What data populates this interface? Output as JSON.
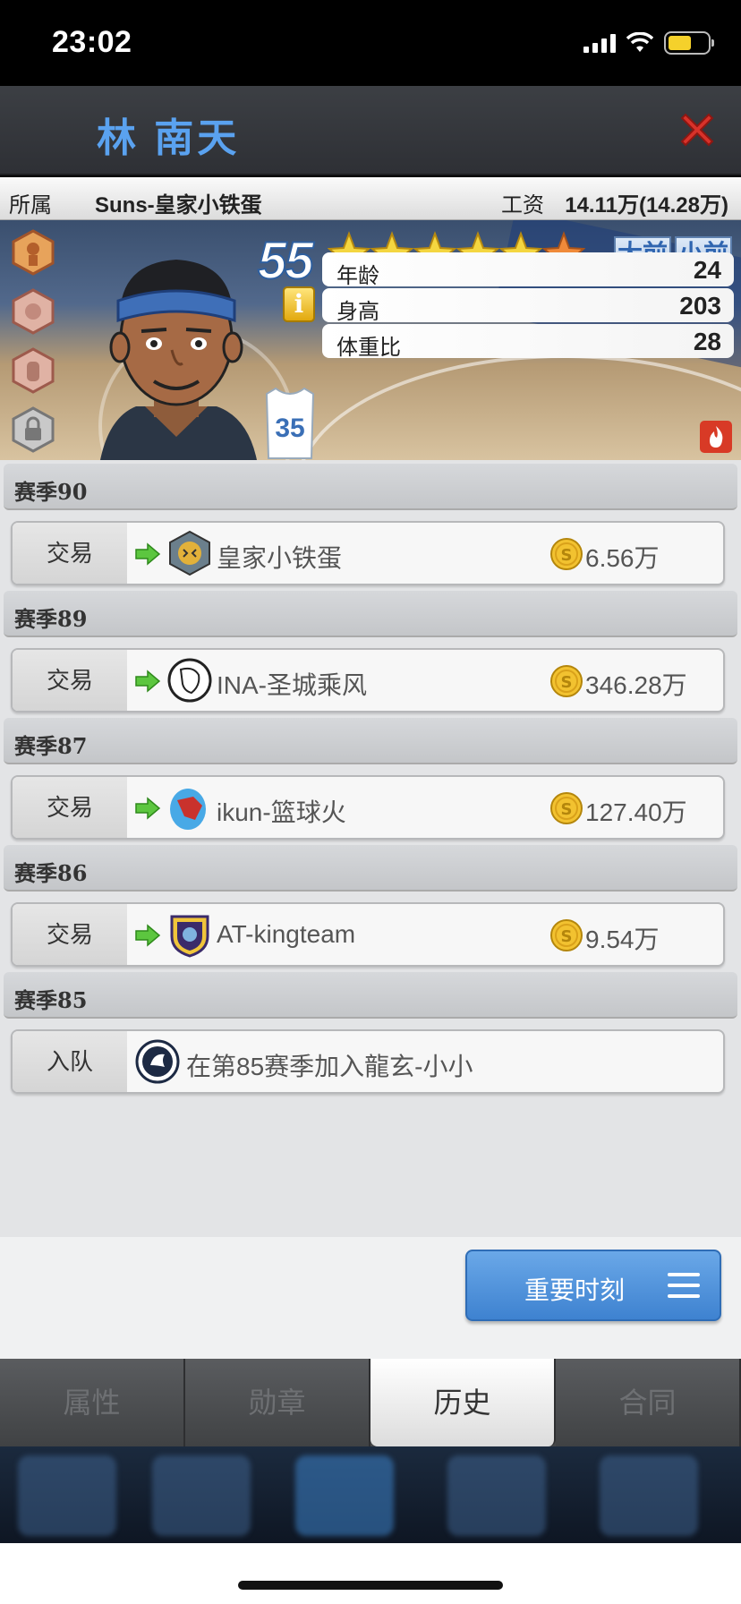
{
  "status_bar": {
    "time": "23:02"
  },
  "header": {
    "player_name": "林 南天"
  },
  "info": {
    "team_label": "所属",
    "team_value": "Suns-皇家小铁蛋",
    "salary_label": "工资",
    "salary_value": "14.11万(14.28万)"
  },
  "card": {
    "rating": "55",
    "stars": 5.5,
    "positions": [
      "大前",
      "小前"
    ],
    "jersey_number": "35",
    "stats": [
      {
        "label": "年龄",
        "value": "24"
      },
      {
        "label": "身高",
        "value": "203"
      },
      {
        "label": "体重比",
        "value": "28"
      }
    ]
  },
  "history": [
    {
      "season": "赛季90",
      "entries": [
        {
          "type": "交易",
          "team": "皇家小铁蛋",
          "amount": "6.56万"
        }
      ]
    },
    {
      "season": "赛季89",
      "entries": [
        {
          "type": "交易",
          "team": "INA-圣城乘风",
          "amount": "346.28万"
        }
      ]
    },
    {
      "season": "赛季87",
      "entries": [
        {
          "type": "交易",
          "team": "ikun-篮球火",
          "amount": "127.40万"
        }
      ]
    },
    {
      "season": "赛季86",
      "entries": [
        {
          "type": "交易",
          "team": "AT-kingteam",
          "amount": "9.54万"
        }
      ]
    },
    {
      "season": "赛季85",
      "entries": [
        {
          "type": "入队",
          "team": "在第85赛季加入龍玄-小小",
          "amount": ""
        }
      ]
    }
  ],
  "moment_button": {
    "label": "重要时刻"
  },
  "tabs": [
    {
      "label": "属性",
      "active": false
    },
    {
      "label": "勋章",
      "active": false
    },
    {
      "label": "历史",
      "active": true
    },
    {
      "label": "合同",
      "active": false
    }
  ],
  "colors": {
    "accent": "#5aa2f0",
    "close": "#d8322a",
    "button": "#4a90dc"
  }
}
